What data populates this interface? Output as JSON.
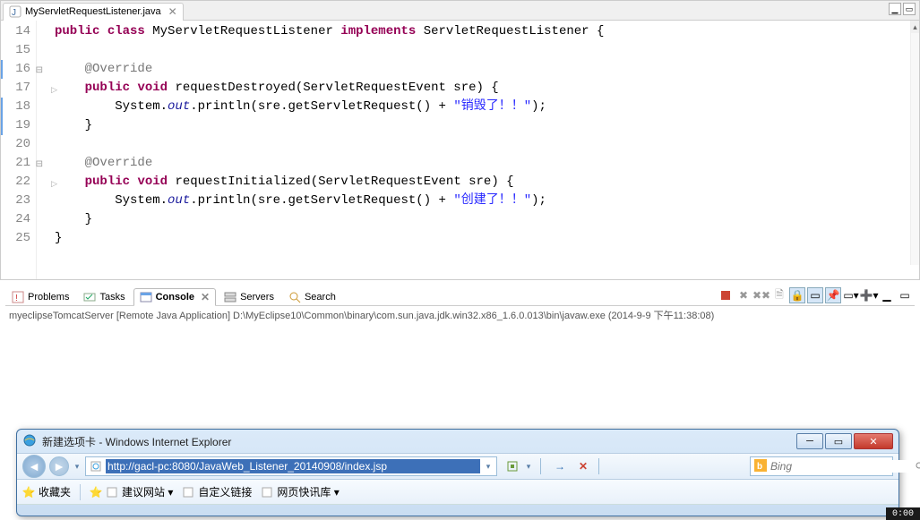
{
  "editor": {
    "tab": {
      "filename": "MyServletRequestListener.java"
    },
    "lines": [
      "14",
      "15",
      "16",
      "17",
      "18",
      "19",
      "20",
      "21",
      "22",
      "23",
      "24",
      "25"
    ],
    "code": {
      "kw_public": "public",
      "kw_class": "class",
      "cls_name": "MyServletRequestListener",
      "kw_implements": "implements",
      "iface": "ServletRequestListener",
      "ann_override": "@Override",
      "kw_void": "void",
      "m1": "requestDestroyed",
      "m2": "requestInitialized",
      "param": "(ServletRequestEvent sre) {",
      "sysout_a": "System.",
      "sysout_b": "out",
      "sysout_c": ".println(sre.getServletRequest() + ",
      "str1": "\"销毁了！！\"",
      "str2": "\"创建了！！\"",
      "tail": ");",
      "rbrace": "}"
    }
  },
  "views": {
    "tabs": {
      "problems": "Problems",
      "tasks": "Tasks",
      "console": "Console",
      "servers": "Servers",
      "search": "Search"
    },
    "console_desc": "myeclipseTomcatServer [Remote Java Application] D:\\MyEclipse10\\Common\\binary\\com.sun.java.jdk.win32.x86_1.6.0.013\\bin\\javaw.exe (2014-9-9 下午11:38:08)"
  },
  "ie": {
    "title": "新建选项卡 - Windows Internet Explorer",
    "url": "http://gacl-pc:8080/JavaWeb_Listener_20140908/index.jsp",
    "search_placeholder": "Bing",
    "fav_label": "收藏夹",
    "link1": "建议网站 ▾",
    "link2": "自定义链接",
    "link3": "网页快讯库 ▾"
  },
  "clock": "0:00"
}
